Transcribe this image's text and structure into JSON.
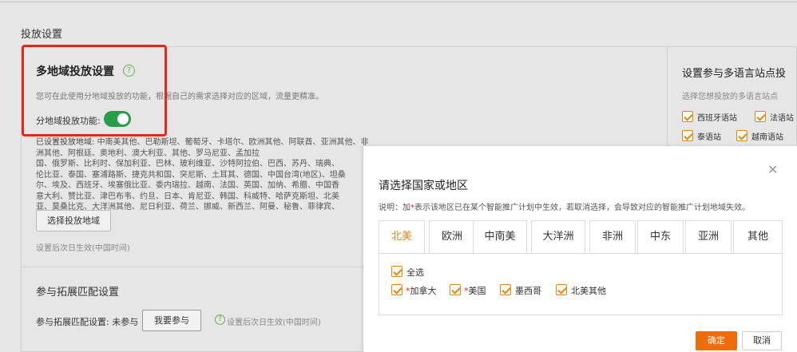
{
  "page": {
    "section_title": "投放设置"
  },
  "multi_region": {
    "title": "多地域投放设置",
    "help_glyph": "?",
    "description": "您可在此使用分地域投放的功能，根据自己的需求选择对应的区域，流量更精准。",
    "toggle_label": "分地域投放功能:",
    "toggle_on": true,
    "regions_label": "已设置投放地域:",
    "regions_lines": [
      "中南美其他、巴勒斯坦、葡萄牙、卡塔尔、欧洲其他、阿联酋、亚洲其他、非洲其他、阿根廷、奥地利、澳大利亚、其他、罗马尼亚、孟加拉",
      "国、俄罗斯、比利时、保加利亚、巴林、玻利维亚、沙特阿拉伯、巴西、苏丹、瑞典、",
      "伦比亚、泰国、塞浦路斯、捷克共和国、突尼斯、土耳其、德国、中国台湾(地区)、坦桑",
      "尔、埃及、西班牙、埃塞俄比亚、委内瑞拉、越南、法国、英国、加纳、希腊、中国香",
      "意大利、赞比亚、津巴布韦、约旦、日本、肯尼亚、韩国、科威特、哈萨克斯坦、北美",
      "亚、莫桑比克、大洋洲其他、尼日利亚、荷兰、挪威、新西兰、阿曼、秘鲁、菲律宾、"
    ],
    "select_button": "选择投放地域",
    "effective_note": "设置后次日生效(中国时间)"
  },
  "expand_match": {
    "title": "参与拓展匹配设置",
    "label": "参与拓展匹配设置: 未参与",
    "join_button": "我要参与",
    "help_glyph": "?",
    "note": "设置后次日生效(中国时间)"
  },
  "language_sites": {
    "title": "设置参与多语言站点投",
    "description": "选择您想投放的多语言站点",
    "sites": [
      {
        "label": "西班牙语站",
        "checked": true
      },
      {
        "label": "法语站",
        "checked": true
      },
      {
        "label": "泰语站",
        "checked": true
      },
      {
        "label": "越南语站",
        "checked": true
      }
    ]
  },
  "modal": {
    "title": "请选择国家或地区",
    "close_glyph": "✕",
    "note_prefix": "说明：加",
    "note_star": "*",
    "note_suffix": "表示该地区已在某个智能推广计划中生效，若取消选择，会导致对应的智能推广计划地域失效。",
    "tabs": [
      "北美",
      "欧洲",
      "中南美",
      "大洋洲",
      "非洲",
      "中东",
      "亚洲",
      "其他"
    ],
    "active_tab": "北美",
    "select_all": "全选",
    "options": [
      {
        "star": "*",
        "label": "加拿大",
        "checked": true
      },
      {
        "star": "*",
        "label": "美国",
        "checked": true
      },
      {
        "star": "",
        "label": "墨西哥",
        "checked": true
      },
      {
        "star": "",
        "label": "北美其他",
        "checked": true
      }
    ],
    "ok_button": "确定",
    "cancel_button": "取消"
  },
  "colors": {
    "accent_orange": "#ef6c0a",
    "toggle_green": "#2a9d4a",
    "highlight_red": "#e8261f"
  }
}
